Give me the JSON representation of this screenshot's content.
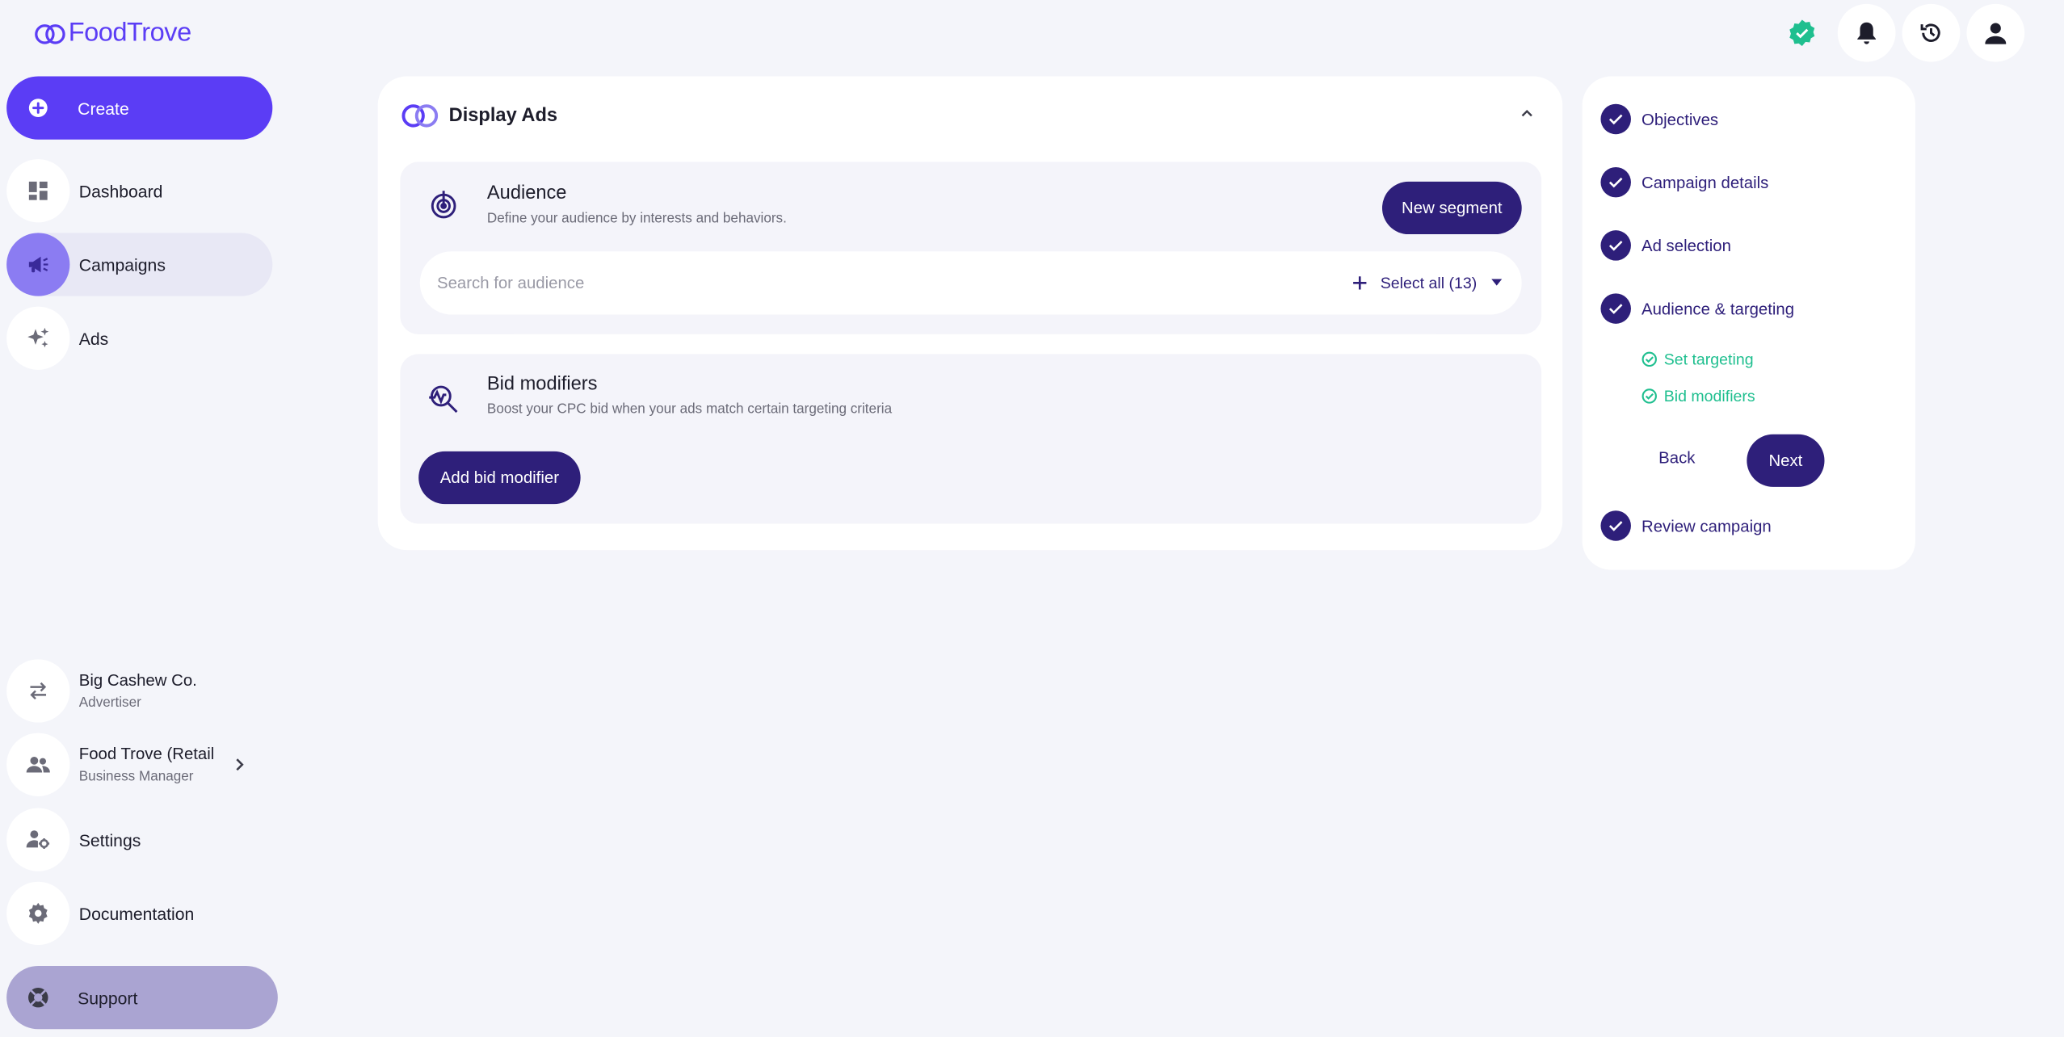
{
  "brand": {
    "name": "FoodTrove",
    "accent": "#5b3df5",
    "dark": "#2e1f7a",
    "success": "#1fbf8f"
  },
  "sidebar": {
    "create_label": "Create",
    "items": [
      {
        "label": "Dashboard",
        "icon": "dashboard-icon"
      },
      {
        "label": "Campaigns",
        "icon": "megaphone-icon",
        "active": true
      },
      {
        "label": "Ads",
        "icon": "sparkles-icon"
      }
    ],
    "accounts": [
      {
        "name": "Big Cashew Co.",
        "role": "Advertiser",
        "icon": "swap-icon"
      },
      {
        "name": "Food Trove (Retail",
        "role": "Business Manager",
        "icon": "users-icon"
      }
    ],
    "settings_label": "Settings",
    "documentation_label": "Documentation",
    "support_label": "Support"
  },
  "header": {
    "icons": [
      "verified-badge-icon",
      "bell-icon",
      "history-icon",
      "user-icon"
    ]
  },
  "main": {
    "title": "Display Ads",
    "audience": {
      "title": "Audience",
      "subtitle": "Define your audience by interests and behaviors.",
      "new_segment_label": "New segment",
      "search_placeholder": "Search for audience",
      "select_all_label": "Select all (13)"
    },
    "bid": {
      "title": "Bid modifiers",
      "subtitle": "Boost your CPC bid when your ads match certain targeting criteria",
      "add_label": "Add bid modifier"
    }
  },
  "stepper": {
    "steps": [
      "Objectives",
      "Campaign details",
      "Ad selection",
      "Audience & targeting",
      "Review campaign"
    ],
    "sub_steps": [
      "Set targeting",
      "Bid modifiers"
    ],
    "back_label": "Back",
    "next_label": "Next"
  }
}
